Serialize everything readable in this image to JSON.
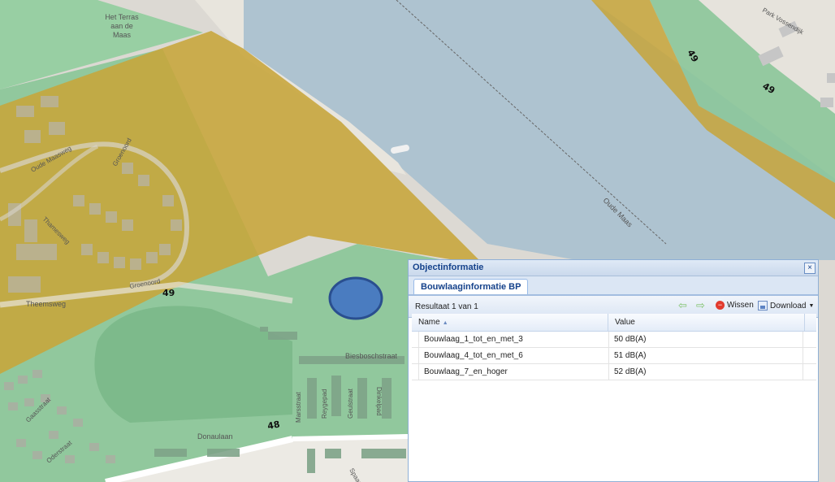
{
  "map": {
    "labels": {
      "terras": [
        "Het Terras",
        "aan de",
        "Maas"
      ],
      "oude_maasweg": "Oude Maasweg",
      "groenoord_top": "Groenoord",
      "groenoord_bottom": "Groenoord",
      "theemsweg": "Theemsweg",
      "thamesweg": "Thamesweg",
      "biesboschstraat": "Biesboschstraat",
      "donaulaan": "Donaulaan",
      "oderstraat": "Oderstraat",
      "gaasstraat": "Gaasstraat",
      "marsstraat": "Marsstraat",
      "reygepad": "Reygepad",
      "geulstraat": "Geulstraat",
      "dinkelpad": "Dinkelpad",
      "park_vossendijk": "Park Vossendijk",
      "oude_maas": "Oude Maas",
      "spaarne": "Spaarne"
    },
    "contours": [
      "49",
      "49",
      "49",
      "48"
    ]
  },
  "panel": {
    "title": "Objectinformatie",
    "close_symbol": "×",
    "tab": "Bouwlaaginformatie BP",
    "result": "Resultaat 1 van 1",
    "wissen": "Wissen",
    "download": "Download",
    "columns": {
      "name": "Name",
      "value": "Value"
    },
    "rows": [
      {
        "name": "Bouwlaag_1_tot_en_met_3",
        "value": "50 dB(A)"
      },
      {
        "name": "Bouwlaag_4_tot_en_met_6",
        "value": "51 dB(A)"
      },
      {
        "name": "Bouwlaag_7_en_hoger",
        "value": "52 dB(A)"
      }
    ]
  },
  "colors": {
    "water": "#aec3d0",
    "yellow_zone": "#c7a53a",
    "green_zone": "#7fbf8f",
    "marker": "#4a7cc0"
  }
}
